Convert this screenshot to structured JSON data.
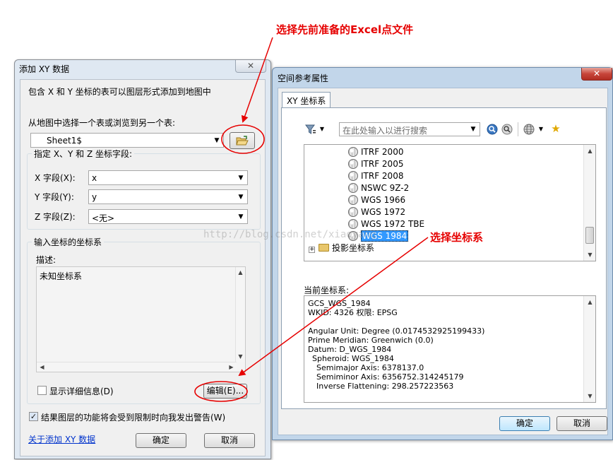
{
  "annotations": {
    "top": "选择先前准备的Excel点文件",
    "right": "选择坐标系",
    "watermark": "http://blog.csdn.net/xiaoyang"
  },
  "add_xy_dialog": {
    "title": "添加 XY 数据",
    "close_label": "✕",
    "intro": "包含 X 和 Y 坐标的表可以图层形式添加到地图中",
    "choose_table_label": "从地图中选择一个表或浏览到另一个表:",
    "table_value": "Sheet1$",
    "fields_group_label": "指定 X、Y 和 Z 坐标字段:",
    "fields": [
      {
        "label": "X 字段(X):",
        "value": "x"
      },
      {
        "label": "Y 字段(Y):",
        "value": "y"
      },
      {
        "label": "Z 字段(Z):",
        "value": "<无>"
      }
    ],
    "coord_group_label": "输入坐标的坐标系",
    "description_label": "描述:",
    "description_value": "未知坐标系",
    "show_details_label": "显示详细信息(D)",
    "show_details_checked": false,
    "edit_button": "编辑(E)...",
    "warn_label": "结果图层的功能将会受到限制时向我发出警告(W)",
    "warn_checked": true,
    "about_link": "关于添加 XY 数据",
    "ok_button": "确定",
    "cancel_button": "取消"
  },
  "spatial_ref_dialog": {
    "title": "空间参考属性",
    "close_label": "✕",
    "tab_label": "XY 坐标系",
    "search_placeholder": "在此处输入以进行搜索",
    "tree_items": [
      "ITRF 2000",
      "ITRF 2005",
      "ITRF 2008",
      "NSWC 9Z-2",
      "WGS 1966",
      "WGS 1972",
      "WGS 1972 TBE",
      "WGS 1984"
    ],
    "selected_item": "WGS 1984",
    "folder_item": "投影坐标系",
    "current_label": "当前坐标系:",
    "current_details": [
      "GCS_WGS_1984",
      "WKID: 4326 权限: EPSG",
      "",
      "Angular Unit: Degree (0.0174532925199433)",
      "Prime Meridian: Greenwich (0.0)",
      "Datum: D_WGS_1984",
      "  Spheroid: WGS_1984",
      "    Semimajor Axis: 6378137.0",
      "    Semiminor Axis: 6356752.314245179",
      "    Inverse Flattening: 298.257223563"
    ],
    "ok_button": "确定",
    "cancel_button": "取消"
  },
  "colors": {
    "annotation": "#e60000",
    "selection": "#3399ff"
  }
}
